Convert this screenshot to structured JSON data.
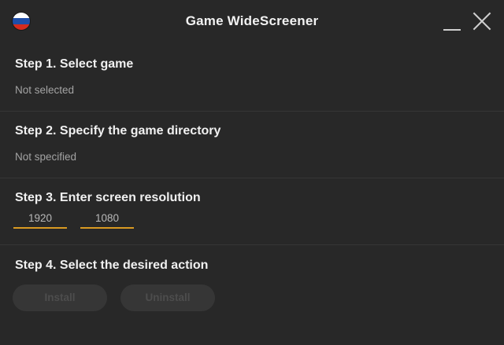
{
  "window": {
    "title": "Game WideScreener",
    "language_flag": "flag-russia-icon",
    "controls": {
      "minimize": "minimize-icon",
      "close": "close-icon"
    }
  },
  "steps": {
    "step1": {
      "title": "Step 1. Select game",
      "value": "Not selected"
    },
    "step2": {
      "title": "Step 2. Specify the game directory",
      "value": "Not specified"
    },
    "step3": {
      "title": "Step 3. Enter screen resolution",
      "width_value": "1920",
      "height_value": "1080"
    },
    "step4": {
      "title": "Step 4. Select the desired action",
      "install_label": "Install",
      "uninstall_label": "Uninstall"
    }
  },
  "colors": {
    "background": "#282828",
    "accent_underline": "#d99a22",
    "disabled_button": "#363636",
    "flag_white": "#ffffff",
    "flag_blue": "#1f4ea8",
    "flag_red": "#d52b1e"
  }
}
